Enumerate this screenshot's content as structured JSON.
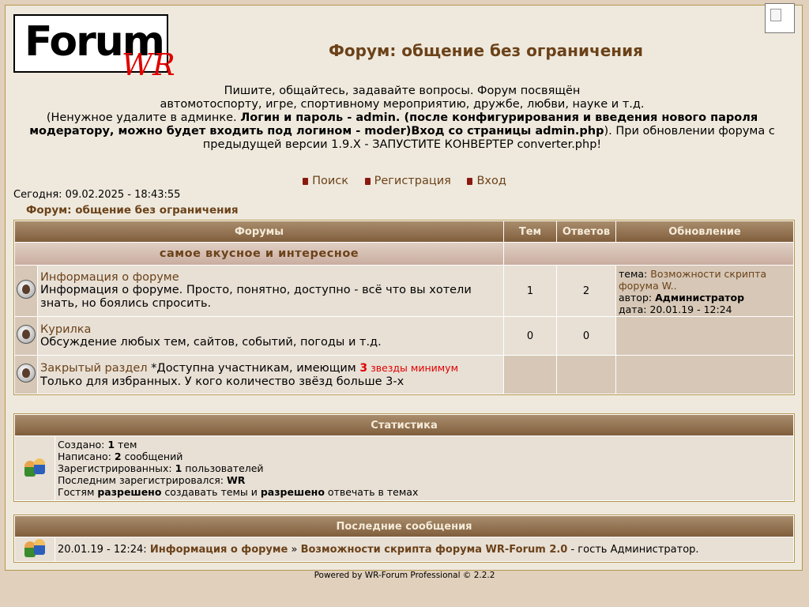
{
  "header": {
    "logo_text": "Forum",
    "logo_accent": "WR",
    "title": "Форум: общение без ограничения",
    "desc_line1": "Пишите, общайтесь, задавайте вопросы. Форум посвящён",
    "desc_line2": "автомотоспорту, игре, спортивному мероприятию, дружбе, любви, науке и т.д.",
    "desc_p1": "(Ненужное удалите в админке. ",
    "desc_b1": "Логин и пароль - admin. (после конфигурирования и введения нового пароля модератору, можно будет входить под логином - moder)Вход со страницы admin.php",
    "desc_p2": "). При обновлении форума с предыдущей версии 1.9.X - ЗАПУСТИТЕ КОНВЕРТЕР converter.php!"
  },
  "nav": {
    "search": "Поиск",
    "register": "Регистрация",
    "login": "Вход"
  },
  "today": "Сегодня: 09.02.2025 - 18:43:55",
  "breadcrumb": "Форум: общение без ограничения",
  "forums_table": {
    "headers": {
      "forums": "Форумы",
      "topics": "Тем",
      "replies": "Ответов",
      "updated": "Обновление"
    },
    "category": "самое вкусное и интересное",
    "rows": [
      {
        "name": "Информация о форуме",
        "desc": "Информация о форуме. Просто, понятно, доступно - всё что вы хотели знать, но боялись спросить.",
        "topics": "1",
        "replies": "2",
        "upd_topic_label": "тема:",
        "upd_topic": "Возможности скрипта форума W..",
        "upd_author_label": "автор:",
        "upd_author": "Администратор",
        "upd_date_label": "дата:",
        "upd_date": "20.01.19 - 12:24"
      },
      {
        "name": "Курилка",
        "desc": "Обсуждение любых тем, сайтов, событий, погоды и т.д.",
        "topics": "0",
        "replies": "0"
      },
      {
        "name": "Закрытый раздел",
        "note": " *Доступна участникам, имеющим ",
        "stars_num": "3",
        "stars_text": " звезды минимум",
        "desc": "Только для избранных. У кого количество звёзд больше 3-х"
      }
    ]
  },
  "stats": {
    "header": "Статистика",
    "created_label": "Создано: ",
    "created_num": "1",
    "created_unit": " тем",
    "written_label": "Написано: ",
    "written_num": "2",
    "written_unit": " сообщений",
    "users_label": "Зарегистрированных: ",
    "users_num": "1",
    "users_unit": " пользователей",
    "last_user_label": "Последним зарегистрировался: ",
    "last_user": "WR",
    "guests_p1": "Гостям ",
    "guests_b1": "разрешено",
    "guests_p2": " создавать темы и ",
    "guests_b2": "разрешено",
    "guests_p3": " отвечать в темах"
  },
  "last_posts": {
    "header": "Последние сообщения",
    "date": "20.01.19 - 12:24: ",
    "forum": "Информация о форуме",
    "sep": " » ",
    "topic": "Возможности скрипта форума WR-Forum 2.0",
    "suffix": " - гость Администратор."
  },
  "footer": "Powered by WR-Forum Professional © 2.2.2",
  "colors": {
    "accent": "#6b4219",
    "header_bg": "#805e3c",
    "page_bg": "#efe9dd"
  }
}
